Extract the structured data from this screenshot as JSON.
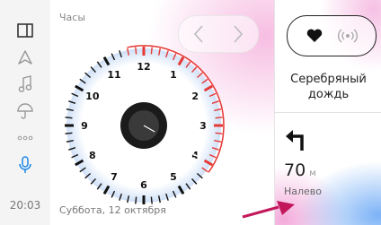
{
  "sidebar": {
    "items": [
      {
        "icon": "panel-layout-icon"
      },
      {
        "icon": "navigation-arrow-icon"
      },
      {
        "icon": "music-note-icon"
      },
      {
        "icon": "umbrella-icon"
      },
      {
        "icon": "more-dots-icon"
      },
      {
        "icon": "microphone-icon",
        "active": true
      }
    ],
    "time": "20:03"
  },
  "clock_app": {
    "label": "Часы",
    "date": "Суббота, 12 октября",
    "nav": {
      "prev": "‹",
      "next": "›"
    },
    "hour_numbers": [
      "12",
      "1",
      "2",
      "3",
      "4",
      "5",
      "6",
      "7",
      "8",
      "9",
      "10",
      "11"
    ],
    "time_shown": {
      "hour": 1,
      "minute": 20
    },
    "timer_arc_color": "#e53935"
  },
  "music": {
    "like_icon": "heart-icon",
    "radio_icon": "radio-waves-icon",
    "title": "Серебряный дождь"
  },
  "navigation_hint": {
    "turn_icon": "turn-left-icon",
    "distance_value": "70",
    "distance_unit": "м",
    "instruction": "Налево"
  },
  "colors": {
    "accent_blue": "#1e88e5",
    "timer_red": "#e53935",
    "annotation_arrow": "#c2185b"
  }
}
